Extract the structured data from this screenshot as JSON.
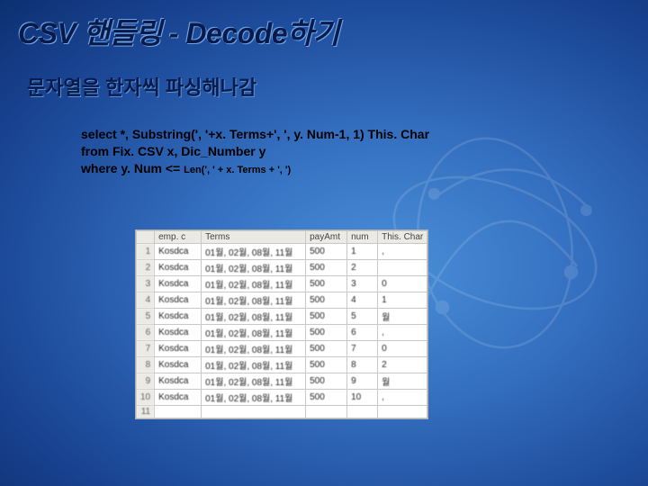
{
  "title": "CSV 핸들링 - Decode하기",
  "subtitle": "문자열을 한자씩 파싱해나감",
  "code": {
    "line1": "select *, Substring(', '+x. Terms+', ', y. Num-1, 1) This. Char",
    "line2": "from Fix. CSV x, Dic_Number y",
    "line3_a": "where y. Num <= ",
    "line3_b": "Len(', ' + x. Terms + ', ')"
  },
  "table": {
    "headers": [
      "",
      "emp. c",
      "Terms",
      "payAmt",
      "num",
      "This. Char"
    ],
    "rows": [
      [
        "1",
        "Kosdca",
        "01월, 02월, 08월, 11월",
        "500",
        "1",
        ","
      ],
      [
        "2",
        "Kosdca",
        "01월, 02월, 08월, 11월",
        "500",
        "2",
        ""
      ],
      [
        "3",
        "Kosdca",
        "01월, 02월, 08월, 11월",
        "500",
        "3",
        "0"
      ],
      [
        "4",
        "Kosdca",
        "01월, 02월, 08월, 11월",
        "500",
        "4",
        "1"
      ],
      [
        "5",
        "Kosdca",
        "01월, 02월, 08월, 11월",
        "500",
        "5",
        "월"
      ],
      [
        "6",
        "Kosdca",
        "01월, 02월, 08월, 11월",
        "500",
        "6",
        ","
      ],
      [
        "7",
        "Kosdca",
        "01월, 02월, 08월, 11월",
        "500",
        "7",
        "0"
      ],
      [
        "8",
        "Kosdca",
        "01월, 02월, 08월, 11월",
        "500",
        "8",
        "2"
      ],
      [
        "9",
        "Kosdca",
        "01월, 02월, 08월, 11월",
        "500",
        "9",
        "월"
      ],
      [
        "10",
        "Kosdca",
        "01월, 02월, 08월, 11월",
        "500",
        "10",
        ","
      ],
      [
        "11",
        "",
        "",
        "",
        "",
        ""
      ]
    ]
  }
}
